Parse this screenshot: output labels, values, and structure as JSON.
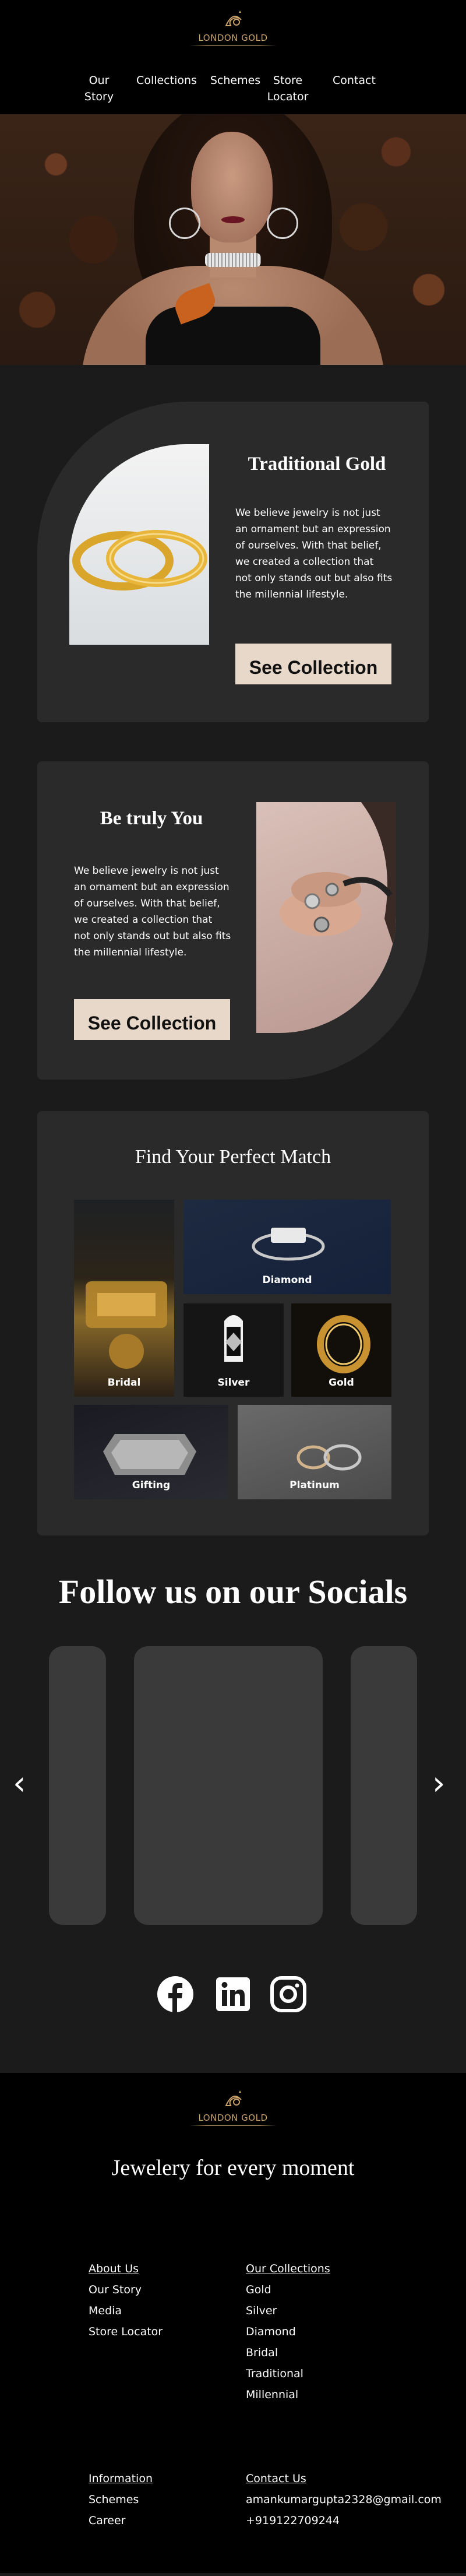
{
  "brand": {
    "name": "LONDON GOLD",
    "accent": "#c9a268"
  },
  "nav": {
    "items": [
      {
        "line1": "Our",
        "line2": "Story"
      },
      {
        "line1": "Collections",
        "line2": ""
      },
      {
        "line1": "Schemes",
        "line2": ""
      },
      {
        "line1": "Store",
        "line2": "Locator"
      },
      {
        "line1": "Contact",
        "line2": ""
      }
    ]
  },
  "traditional": {
    "title": "Traditional Gold",
    "text": "We believe jewelry is not just an ornament but an expression of ourselves. With that belief, we created a collection that not only stands out but also fits the millennial lifestyle.",
    "button": "See Collection"
  },
  "truly": {
    "title": "Be truly You",
    "text": "We believe jewelry is not just an ornament but an expression of ourselves. With that belief, we created a collection that not only stands out but also fits the millennial lifestyle.",
    "button": "See Collection"
  },
  "match": {
    "title": "Find Your Perfect Match",
    "tiles": [
      "Bridal",
      "Diamond",
      "Silver",
      "Gold",
      "Gifting",
      "Platinum"
    ]
  },
  "social": {
    "title": "Follow us on our Socials",
    "icons": [
      "facebook-icon",
      "linkedin-icon",
      "instagram-icon"
    ]
  },
  "footer": {
    "tagline": "Jewelery for every moment",
    "about": {
      "heading": "About Us",
      "links": [
        "Our Story",
        "Media",
        "Store Locator"
      ]
    },
    "collections": {
      "heading": "Our Collections",
      "links": [
        "Gold",
        "Silver",
        "Diamond",
        "Bridal",
        "Traditional",
        "Millennial"
      ]
    },
    "information": {
      "heading": "Information",
      "links": [
        "Schemes",
        "Career"
      ]
    },
    "contact": {
      "heading": "Contact Us",
      "email": "amankumargupta2328@gmail.com",
      "phone": "+919122709244"
    }
  }
}
